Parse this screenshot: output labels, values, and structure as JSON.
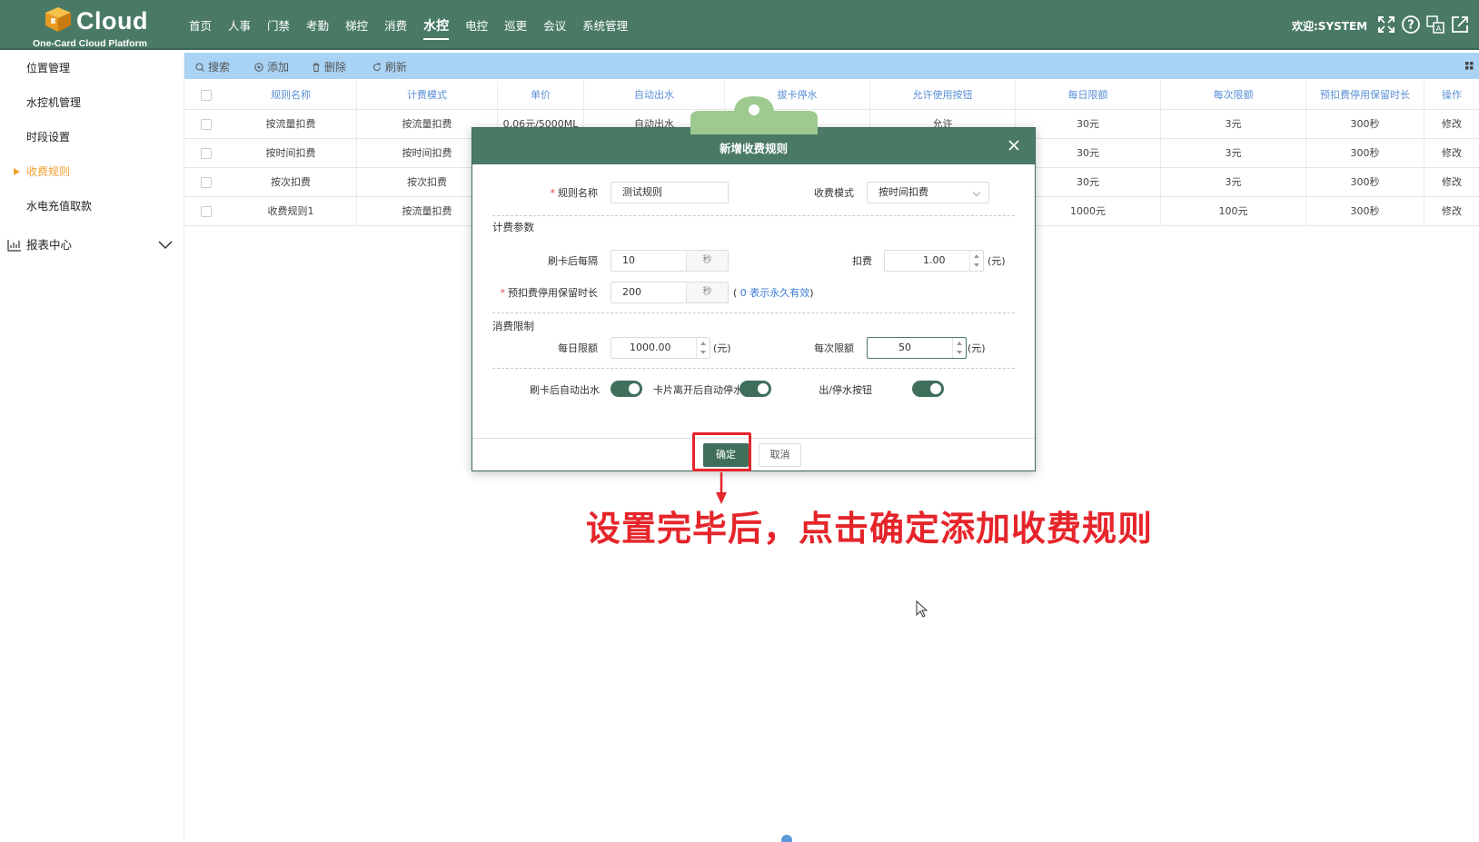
{
  "header": {
    "logo_word": "Cloud",
    "logo_sub": "One-Card Cloud Platform",
    "nav": [
      "首页",
      "人事",
      "门禁",
      "考勤",
      "梯控",
      "消费",
      "水控",
      "电控",
      "巡更",
      "会议",
      "系统管理"
    ],
    "active_nav": "水控",
    "welcome": "欢迎:SYSTEM",
    "icons": [
      "fullscreen-icon",
      "help-icon",
      "language-icon",
      "logout-icon"
    ]
  },
  "sidebar": {
    "items": [
      {
        "label": "位置管理"
      },
      {
        "label": "水控机管理"
      },
      {
        "label": "时段设置"
      },
      {
        "label": "收费规则",
        "active": true
      },
      {
        "label": "水电充值取款"
      }
    ],
    "group": {
      "label": "报表中心"
    }
  },
  "toolbar": {
    "search": "搜索",
    "add": "添加",
    "delete": "删除",
    "refresh": "刷新"
  },
  "table": {
    "columns": [
      "规则名称",
      "计费模式",
      "单价",
      "自动出水",
      "拔卡停水",
      "允许使用按钮",
      "每日限额",
      "每次限额",
      "预扣费停用保留时长",
      "操作"
    ],
    "rows": [
      [
        "按流量扣费",
        "按流量扣费",
        "0.06元/5000ML",
        "自动出水",
        "",
        "允许",
        "30元",
        "3元",
        "300秒",
        "修改"
      ],
      [
        "按时间扣费",
        "按时间扣费",
        "",
        "",
        "",
        "",
        "30元",
        "3元",
        "300秒",
        "修改"
      ],
      [
        "按次扣费",
        "按次扣费",
        "",
        "",
        "",
        "",
        "30元",
        "3元",
        "300秒",
        "修改"
      ],
      [
        "收费规则1",
        "按流量扣费",
        "",
        "",
        "",
        "",
        "1000元",
        "100元",
        "300秒",
        "修改"
      ]
    ]
  },
  "modal": {
    "title": "新增收费规则",
    "rule_name_label": "规则名称",
    "rule_name_value": "测试规则",
    "mode_label": "收费模式",
    "mode_value": "按时间扣费",
    "billing_section": "计费参数",
    "interval_label": "刷卡后每隔",
    "interval_value": "10",
    "interval_unit": "秒",
    "fee_label": "扣费",
    "fee_value": "1.00",
    "fee_unit": "(元)",
    "hold_label": "预扣费停用保留时长",
    "hold_value": "200",
    "hold_unit": "秒",
    "hold_hint_prefix": "(",
    "hold_hint": "0 表示永久有效",
    "hold_hint_suffix": ")",
    "limit_section": "消费限制",
    "daily_label": "每日限额",
    "daily_value": "1000.00",
    "daily_unit": "(元)",
    "each_label": "每次限额",
    "each_value": "50",
    "each_unit": "(元)",
    "auto_water_label": "刷卡后自动出水",
    "auto_water_on": true,
    "card_leave_label": "卡片离开后自动停水",
    "card_leave_on": true,
    "button_label": "出/停水按钮",
    "button_on": true,
    "ok": "确定",
    "cancel": "取消"
  },
  "annotation": "设置完毕后，点击确定添加收费规则",
  "colors": {
    "header": "#4a7a66",
    "toolbar": "#a9d3f5",
    "accent": "#f0a030",
    "annotation": "#e5252a"
  }
}
